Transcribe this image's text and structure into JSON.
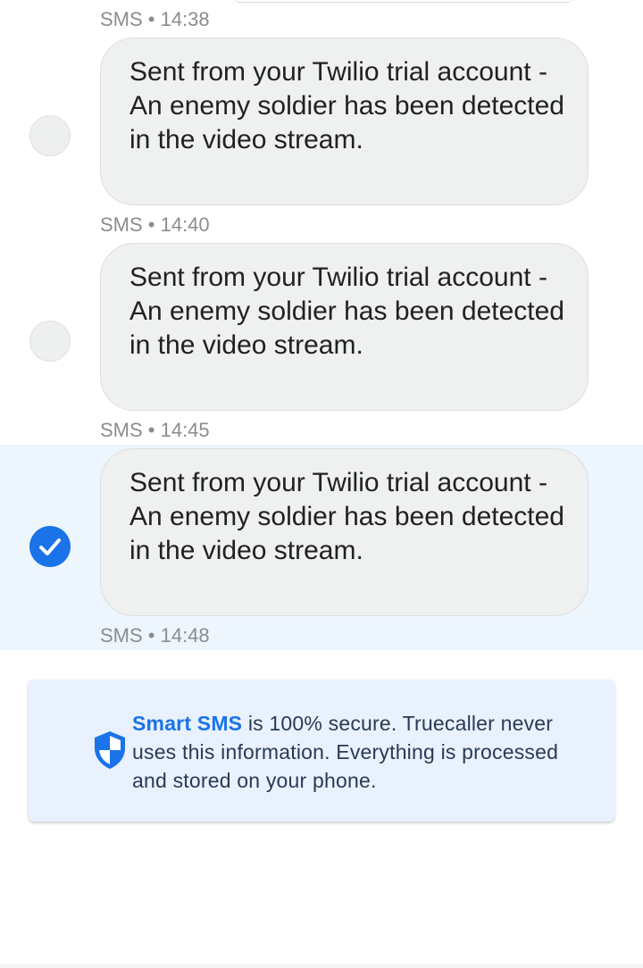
{
  "messages": [
    {
      "timestamp": "SMS • 14:38",
      "text": "Sent from your Twilio trial account - An enemy soldier has been detected in the video stream.",
      "selected": false
    },
    {
      "timestamp": "SMS • 14:40",
      "text": "Sent from your Twilio trial account - An enemy soldier has been detected in the video stream.",
      "selected": false
    },
    {
      "timestamp": "SMS • 14:45",
      "text": "Sent from your Twilio trial account - An enemy soldier has been detected in the video stream.",
      "selected": true
    }
  ],
  "last_timestamp": "SMS • 14:48",
  "security_notice": {
    "brand": "Smart SMS",
    "text": " is 100% secure. Truecaller never uses this information. Everything is processed and stored on your phone.",
    "icon": "shield-icon"
  },
  "colors": {
    "accent": "#1a73e8",
    "bubble_bg": "#eff0f0",
    "selected_row_bg": "#edf5fd",
    "notice_bg": "#e8f1fd"
  },
  "icons": {
    "selected": "checkmark-circle-icon",
    "unselected": "empty-circle-icon"
  }
}
